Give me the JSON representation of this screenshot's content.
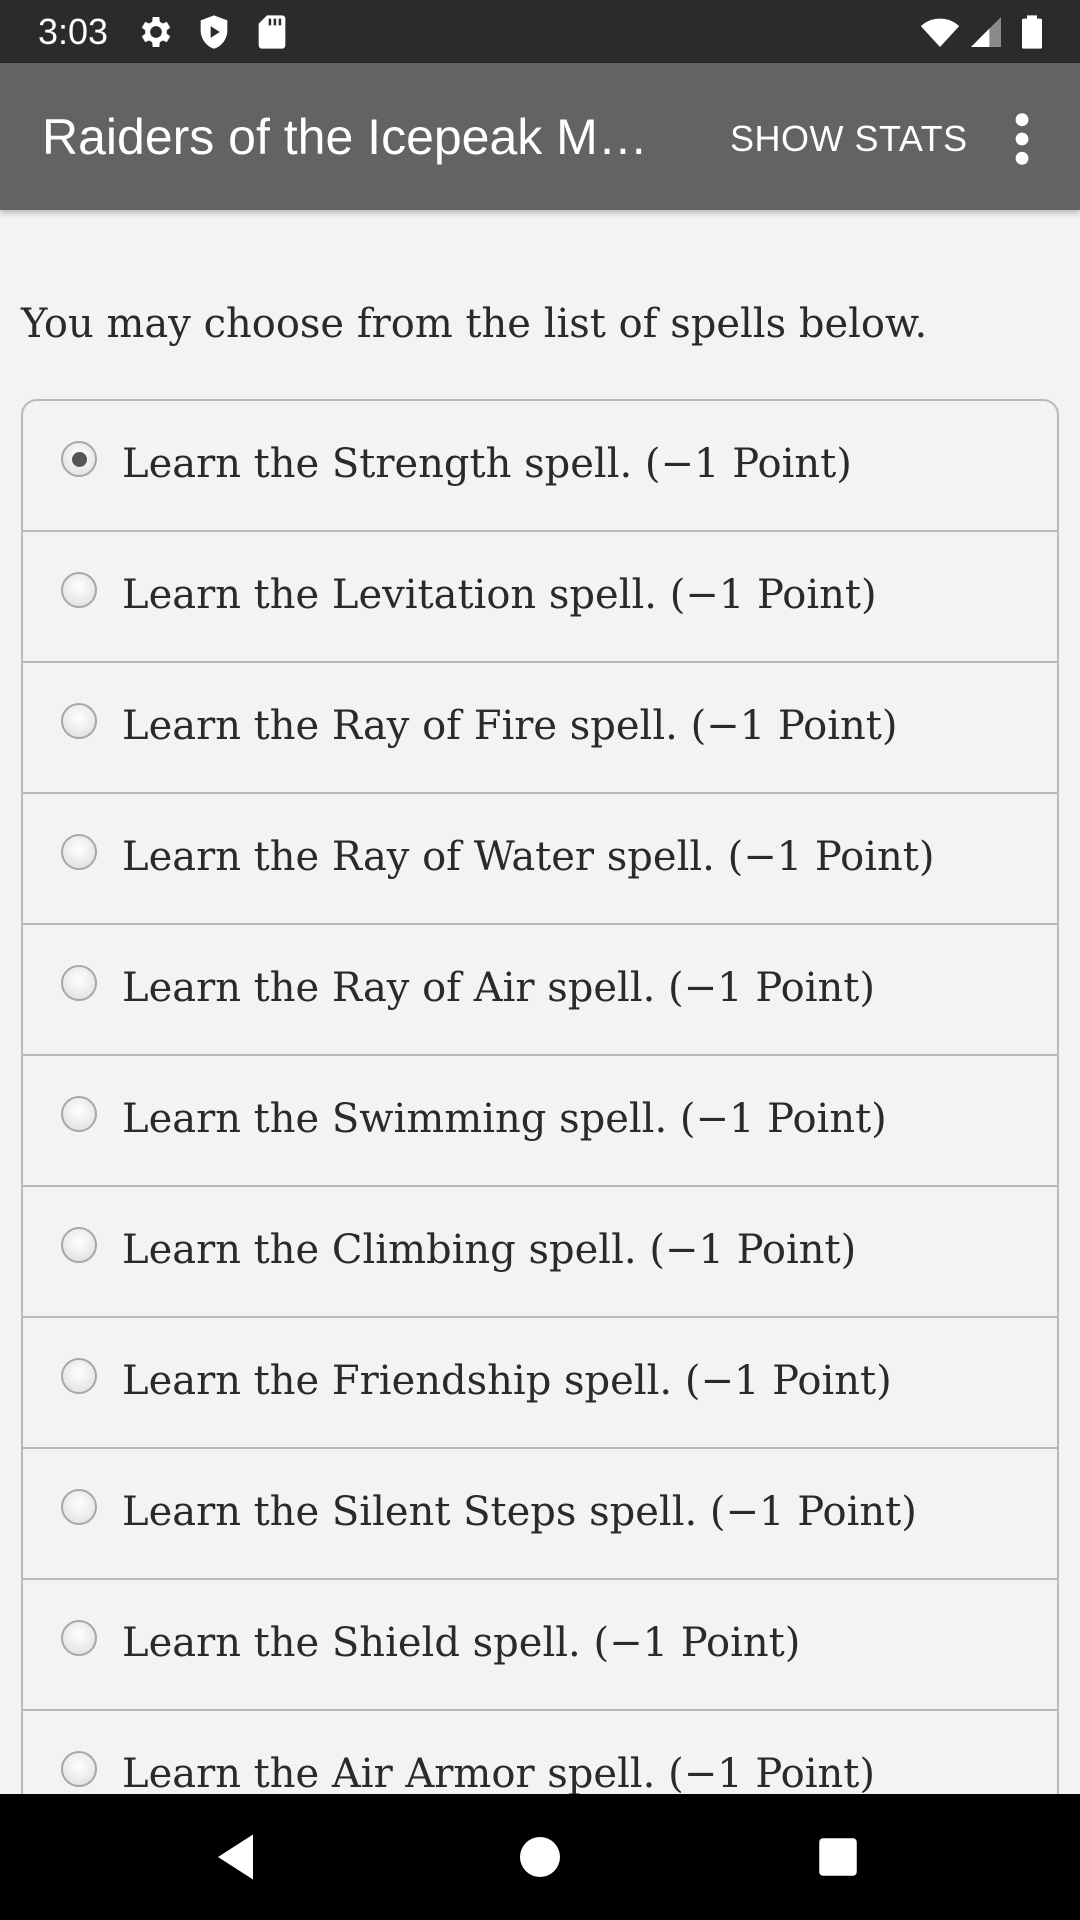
{
  "status_bar": {
    "time": "3:03",
    "icons": [
      "gear-icon",
      "shield-icon",
      "sd-card-icon",
      "wifi-icon",
      "signal-icon",
      "battery-icon"
    ]
  },
  "app_bar": {
    "title": "Raiders of the Icepeak Mountain",
    "show_stats_label": "SHOW STATS",
    "overflow_icon": "more-vert-icon"
  },
  "content": {
    "intro": "You may choose from the list of spells below.",
    "options": [
      {
        "label": "Learn the Strength spell. (−1 Point)",
        "selected": true
      },
      {
        "label": "Learn the Levitation spell. (−1 Point)",
        "selected": false
      },
      {
        "label": "Learn the Ray of Fire spell. (−1 Point)",
        "selected": false
      },
      {
        "label": "Learn the Ray of Water spell. (−1 Point)",
        "selected": false
      },
      {
        "label": "Learn the Ray of Air spell. (−1 Point)",
        "selected": false
      },
      {
        "label": "Learn the Swimming spell. (−1 Point)",
        "selected": false
      },
      {
        "label": "Learn the Climbing spell. (−1 Point)",
        "selected": false
      },
      {
        "label": "Learn the Friendship spell. (−1 Point)",
        "selected": false
      },
      {
        "label": "Learn the Silent Steps spell. (−1 Point)",
        "selected": false
      },
      {
        "label": "Learn the Shield spell. (−1 Point)",
        "selected": false
      },
      {
        "label": "Learn the Air Armor spell. (−1 Point)",
        "selected": false
      }
    ]
  },
  "nav_bar": {
    "buttons": [
      "back-icon",
      "home-icon",
      "recents-icon"
    ]
  },
  "colors": {
    "status_bar": "#2b2b2b",
    "app_bar": "#636363",
    "background": "#f5f3f1",
    "border": "#b9b9b9",
    "text": "#2a2a2a",
    "nav_bar": "#000000"
  }
}
